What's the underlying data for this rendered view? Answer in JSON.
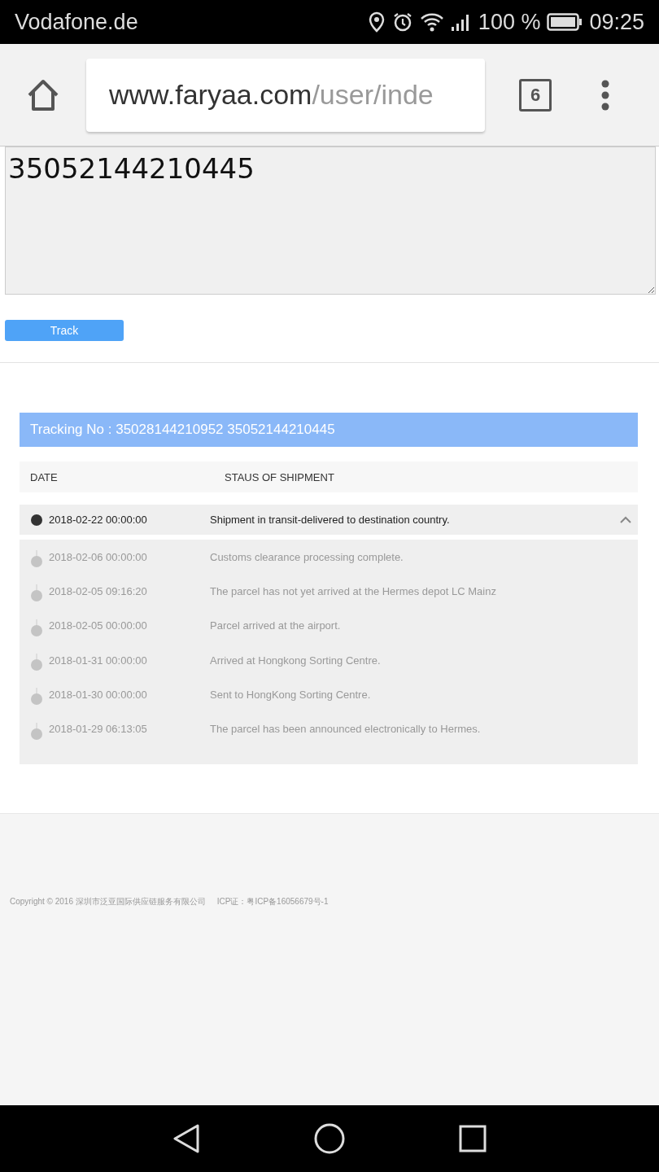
{
  "status_bar": {
    "carrier": "Vodafone.de",
    "battery": "100 %",
    "time": "09:25"
  },
  "browser": {
    "url_host": "www.faryaa.com",
    "url_path": "/user/inde",
    "tab_count": "6"
  },
  "form": {
    "tracking_input": "35052144210445",
    "button": "Track"
  },
  "result": {
    "title": "Tracking No :  35028144210952 35052144210445",
    "columns": [
      "DATE",
      "STAUS OF SHIPMENT"
    ],
    "latest": {
      "date": "2018-02-22 00:00:00",
      "status": "Shipment in transit-delivered to destination country.",
      "expanded": true
    },
    "history": [
      {
        "date": "2018-02-06 00:00:00",
        "status": "Customs clearance processing complete."
      },
      {
        "date": "2018-02-05 09:16:20",
        "status": "The parcel has not yet arrived at the Hermes depot LC Mainz"
      },
      {
        "date": "2018-02-05 00:00:00",
        "status": "Parcel arrived at the airport."
      },
      {
        "date": "2018-01-31 00:00:00",
        "status": "Arrived at Hongkong Sorting Centre."
      },
      {
        "date": "2018-01-30 00:00:00",
        "status": "Sent to HongKong Sorting Centre."
      },
      {
        "date": "2018-01-29 06:13:05",
        "status": "The parcel has been announced electronically to Hermes."
      }
    ]
  },
  "footer": {
    "copyright": "Copyright © 2016  深圳市泛亚国际供应链服务有限公司",
    "icp": "ICP证：粤ICP备16056679号-1"
  }
}
